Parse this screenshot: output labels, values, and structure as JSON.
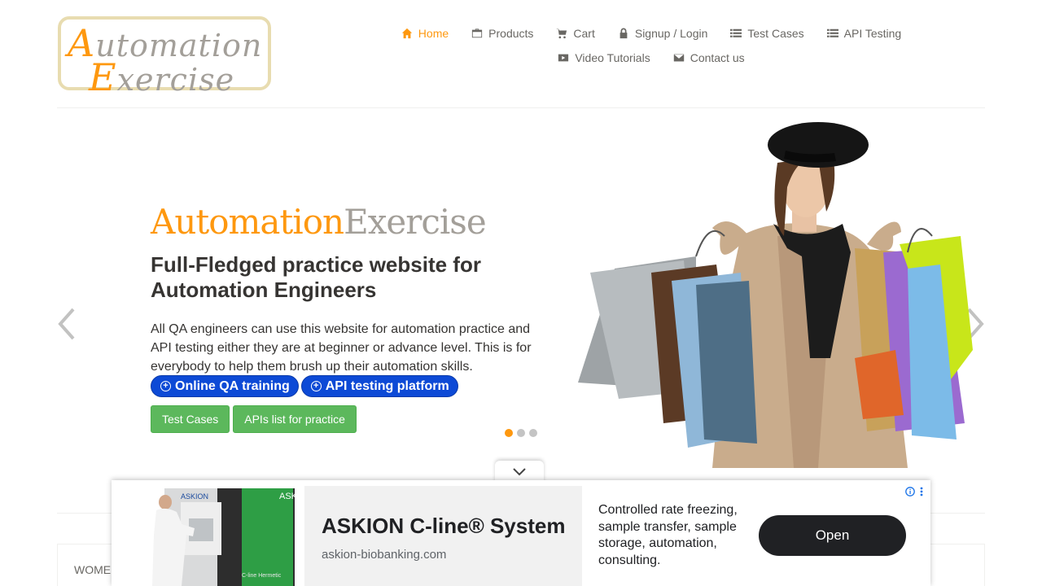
{
  "logo": {
    "line1_cap": "A",
    "line1_rest": "utomation",
    "line2_cap": "E",
    "line2_rest": "xercise"
  },
  "nav": {
    "items": [
      {
        "label": "Home",
        "icon": "home-icon"
      },
      {
        "label": "Products",
        "icon": "briefcase-icon"
      },
      {
        "label": "Cart",
        "icon": "cart-icon"
      },
      {
        "label": "Signup / Login",
        "icon": "lock-icon"
      },
      {
        "label": "Test Cases",
        "icon": "list-icon"
      },
      {
        "label": "API Testing",
        "icon": "list-icon"
      },
      {
        "label": "Video Tutorials",
        "icon": "youtube-icon"
      },
      {
        "label": "Contact us",
        "icon": "envelope-icon"
      }
    ]
  },
  "slider": {
    "brand_a": "Automation",
    "brand_b": "Exercise",
    "headline": "Full-Fledged practice website for Automation Engineers",
    "description": "All QA engineers can use this website for automation practice and API testing either they are at beginner or advance level. This is for everybody to help them brush up their automation skills.",
    "pill_1": "Online QA training",
    "pill_2": "API testing platform",
    "btn_test_cases": "Test Cases",
    "btn_apis": "APIs list for practice",
    "active_slide": 1,
    "slide_count": 3
  },
  "category": {
    "label": "WOMEN"
  },
  "ad": {
    "title": "ASKION C-line® System",
    "url": "askion-biobanking.com",
    "copy": "Controlled rate freezing, sample transfer, sample storage, automation, consulting.",
    "open_label": "Open",
    "mark_label": "ASKION",
    "device_label": "C-line Hermetic"
  },
  "colors": {
    "accent": "#fe980f",
    "brand_grey": "#a39f99",
    "pill_blue": "#0d4ad6",
    "green": "#5cb85c"
  }
}
